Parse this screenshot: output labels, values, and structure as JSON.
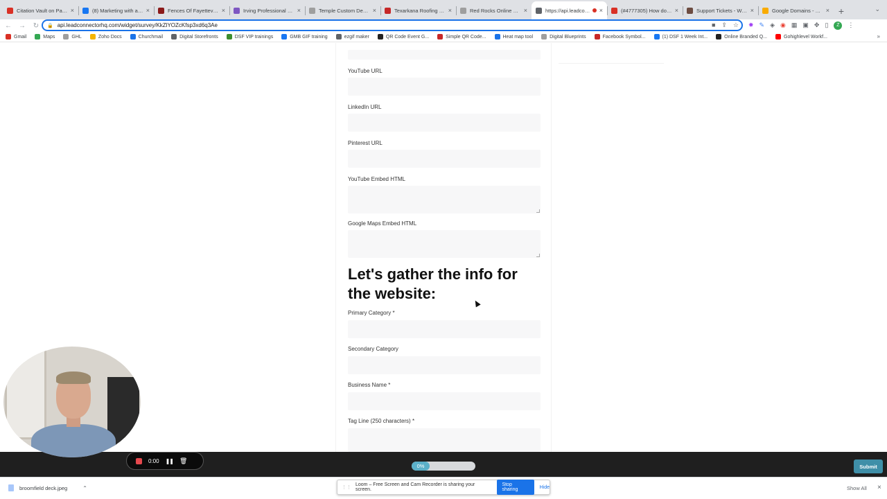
{
  "browser": {
    "tabs": [
      {
        "title": "Citation Vault on Pass...",
        "color": "#d93025",
        "active": false
      },
      {
        "title": "(8) Marketing with a M...",
        "color": "#1877f2",
        "active": false
      },
      {
        "title": "Fences Of Fayettevill...",
        "color": "#8b1a1a",
        "active": false
      },
      {
        "title": "Irving Professional De...",
        "color": "#7e57c2",
        "active": false
      },
      {
        "title": "Temple Custom Decks...",
        "color": "#9e9e9e",
        "active": false
      },
      {
        "title": "Texarkana Roofing Pro...",
        "color": "#c62828",
        "active": false
      },
      {
        "title": "Red Rocks Online Sol...",
        "color": "#9e9e9e",
        "active": false
      },
      {
        "title": "https://api.leadcon...",
        "color": "#5f6368",
        "active": true,
        "recording": true
      },
      {
        "title": "(#4777305) How do I...",
        "color": "#d93025",
        "active": false
      },
      {
        "title": "Support Tickets - Wel...",
        "color": "#6d4c41",
        "active": false
      },
      {
        "title": "Google Domains - DN...",
        "color": "#f9ab00",
        "active": false
      }
    ],
    "url": "api.leadconnectorhq.com/widget/survey/KkZlYOZcKfsp3xd6q3Ae",
    "profile_initial": "Z",
    "bookmarks": [
      {
        "label": "Gmail",
        "color": "#d93025"
      },
      {
        "label": "Maps",
        "color": "#34a853"
      },
      {
        "label": "GHL",
        "color": "#9e9e9e"
      },
      {
        "label": "Zoho Docs",
        "color": "#f4b400"
      },
      {
        "label": "Churchmail",
        "color": "#1a73e8"
      },
      {
        "label": "Digital Storefronts",
        "color": "#5f6368"
      },
      {
        "label": "DSF VIP trainings",
        "color": "#3c8d2f"
      },
      {
        "label": "GMB GIF training",
        "color": "#1877f2"
      },
      {
        "label": "ezgif maker",
        "color": "#5f6368"
      },
      {
        "label": "QR Code Event G...",
        "color": "#222222"
      },
      {
        "label": "Simple QR Code...",
        "color": "#c62828"
      },
      {
        "label": "Heat map tool",
        "color": "#1a73e8"
      },
      {
        "label": "Digital Blueprints",
        "color": "#9e9e9e"
      },
      {
        "label": "Facebook Symbol...",
        "color": "#c62828"
      },
      {
        "label": "(1) DSF 1 Week Int...",
        "color": "#1877f2"
      },
      {
        "label": "Online Branded Q...",
        "color": "#222222"
      },
      {
        "label": "Gohighlevel Workf...",
        "color": "#ff0000"
      }
    ]
  },
  "form": {
    "fields_top": [
      {
        "label": "YouTube URL"
      },
      {
        "label": "LinkedIn URL"
      },
      {
        "label": "Pinterest URL"
      },
      {
        "label": "YouTube Embed HTML"
      },
      {
        "label": "Google Maps Embed HTML"
      }
    ],
    "section_heading": "Let's gather the info for the website:",
    "fields_bottom": [
      {
        "label": "Primary Category *"
      },
      {
        "label": "Secondary Category"
      },
      {
        "label": "Business Name *"
      },
      {
        "label": "Tag Line (250 characters) *"
      }
    ],
    "progress_percent": 0,
    "progress_label": "0%",
    "submit_label": "Submit"
  },
  "recorder": {
    "timer": "0:00",
    "banner_text": "Loom – Free Screen and Cam Recorder is sharing your screen.",
    "stop_label": "Stop sharing",
    "hide_label": "Hide"
  },
  "downloads": {
    "file_name": "broomfield deck.jpeg",
    "show_all_label": "Show All"
  }
}
